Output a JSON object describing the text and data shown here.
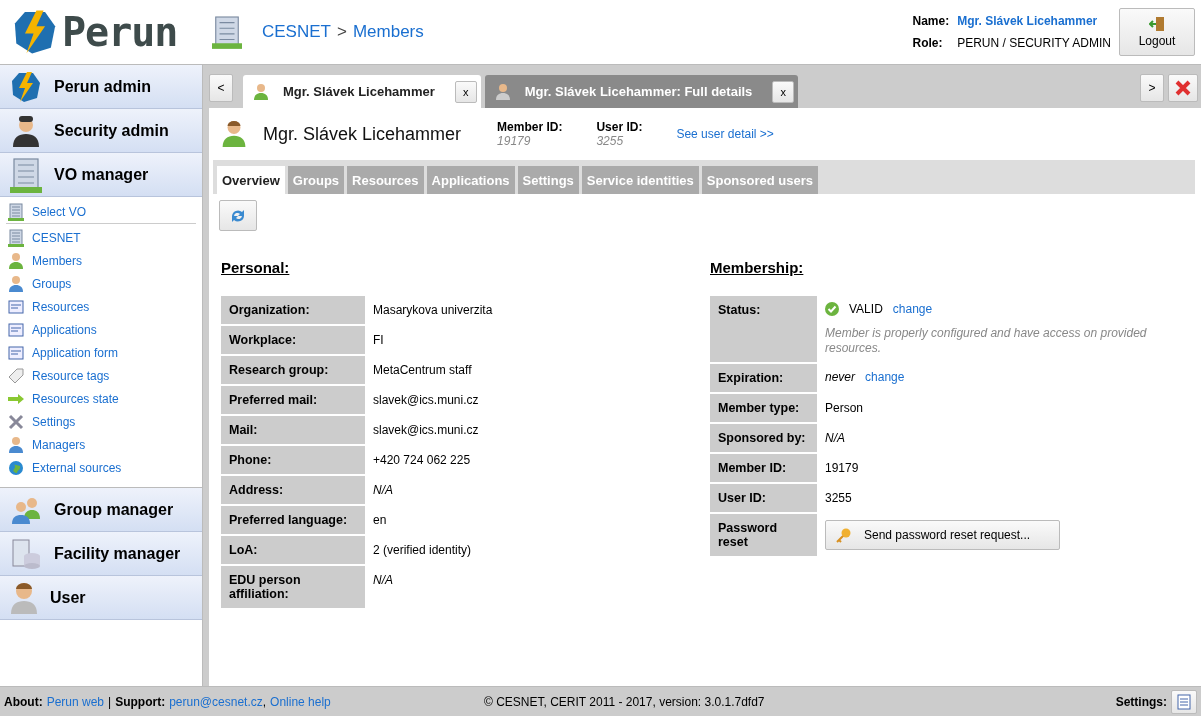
{
  "header": {
    "logo": "Perun",
    "breadcrumb": [
      {
        "label": "CESNET"
      },
      {
        "label": "Members"
      }
    ],
    "separator": ">",
    "user": {
      "name_label": "Name:",
      "name": "Mgr. Slávek Licehammer",
      "role_label": "Role:",
      "role": "PERUN / SECURITY ADMIN"
    },
    "logout": "Logout"
  },
  "sidebar": {
    "sections": [
      {
        "label": "Perun admin"
      },
      {
        "label": "Security admin"
      },
      {
        "label": "VO manager",
        "items": [
          {
            "label": "Select VO"
          },
          {
            "label": "CESNET"
          },
          {
            "label": "Members"
          },
          {
            "label": "Groups"
          },
          {
            "label": "Resources"
          },
          {
            "label": "Applications"
          },
          {
            "label": "Application form"
          },
          {
            "label": "Resource tags"
          },
          {
            "label": "Resources state"
          },
          {
            "label": "Settings"
          },
          {
            "label": "Managers"
          },
          {
            "label": "External sources"
          }
        ]
      },
      {
        "label": "Group manager"
      },
      {
        "label": "Facility manager"
      },
      {
        "label": "User"
      }
    ]
  },
  "tabbar": {
    "prev": "<",
    "next": ">",
    "tabs": [
      {
        "label": "Mgr. Slávek Licehammer",
        "selected": true,
        "close": "x"
      },
      {
        "label": "Mgr. Slávek Licehammer: Full details",
        "selected": false,
        "close": "x"
      }
    ]
  },
  "member": {
    "name": "Mgr. Slávek Licehammer",
    "member_id_label": "Member ID:",
    "member_id": "19179",
    "user_id_label": "User ID:",
    "user_id": "3255",
    "link": "See user detail >>"
  },
  "subtabs": [
    {
      "label": "Overview",
      "selected": true
    },
    {
      "label": "Groups",
      "selected": false
    },
    {
      "label": "Resources",
      "selected": false
    },
    {
      "label": "Applications",
      "selected": false
    },
    {
      "label": "Settings",
      "selected": false
    },
    {
      "label": "Service identities",
      "selected": false
    },
    {
      "label": "Sponsored users",
      "selected": false
    }
  ],
  "personal": {
    "title": "Personal:",
    "rows": [
      {
        "label": "Organization:",
        "value": "Masarykova univerzita",
        "emphasis": false
      },
      {
        "label": "Workplace:",
        "value": "FI",
        "emphasis": false
      },
      {
        "label": "Research group:",
        "value": "MetaCentrum staff",
        "emphasis": false
      },
      {
        "label": "Preferred mail:",
        "value": "slavek@ics.muni.cz",
        "emphasis": false
      },
      {
        "label": "Mail:",
        "value": "slavek@ics.muni.cz",
        "emphasis": false
      },
      {
        "label": "Phone:",
        "value": "+420 724 062 225",
        "emphasis": false
      },
      {
        "label": "Address:",
        "value": "N/A",
        "emphasis": true
      },
      {
        "label": "Preferred language:",
        "value": "en",
        "emphasis": false
      },
      {
        "label": "LoA:",
        "value": "2 (verified identity)",
        "emphasis": false
      },
      {
        "label": "EDU person affiliation:",
        "value": "N/A",
        "emphasis": true
      }
    ]
  },
  "membership": {
    "title": "Membership:",
    "rows": [
      {
        "kind": "status",
        "label": "Status:",
        "value": "VALID",
        "link": "change",
        "note": "Member is properly configured and have access on provided resources."
      },
      {
        "kind": "link",
        "label": "Expiration:",
        "value": "never",
        "link": "change",
        "emphasis": true
      },
      {
        "kind": "text",
        "label": "Member type:",
        "value": "Person",
        "emphasis": false
      },
      {
        "kind": "text",
        "label": "Sponsored by:",
        "value": "N/A",
        "emphasis": true
      },
      {
        "kind": "text",
        "label": "Member ID:",
        "value": "19179",
        "emphasis": false
      },
      {
        "kind": "text",
        "label": "User ID:",
        "value": "3255",
        "emphasis": false
      },
      {
        "kind": "button",
        "label": "Password reset",
        "value": "Send password reset request..."
      }
    ]
  },
  "footer": {
    "about_label": "About:",
    "about_link": "Perun web",
    "divider": "|",
    "support_label": "Support:",
    "support_email": "perun@cesnet.cz",
    "comma": ",",
    "help_link": "Online help",
    "copyright": "© CESNET, CERIT 2011 - 2017, version: 3.0.1.7dfd7",
    "settings_label": "Settings:"
  }
}
